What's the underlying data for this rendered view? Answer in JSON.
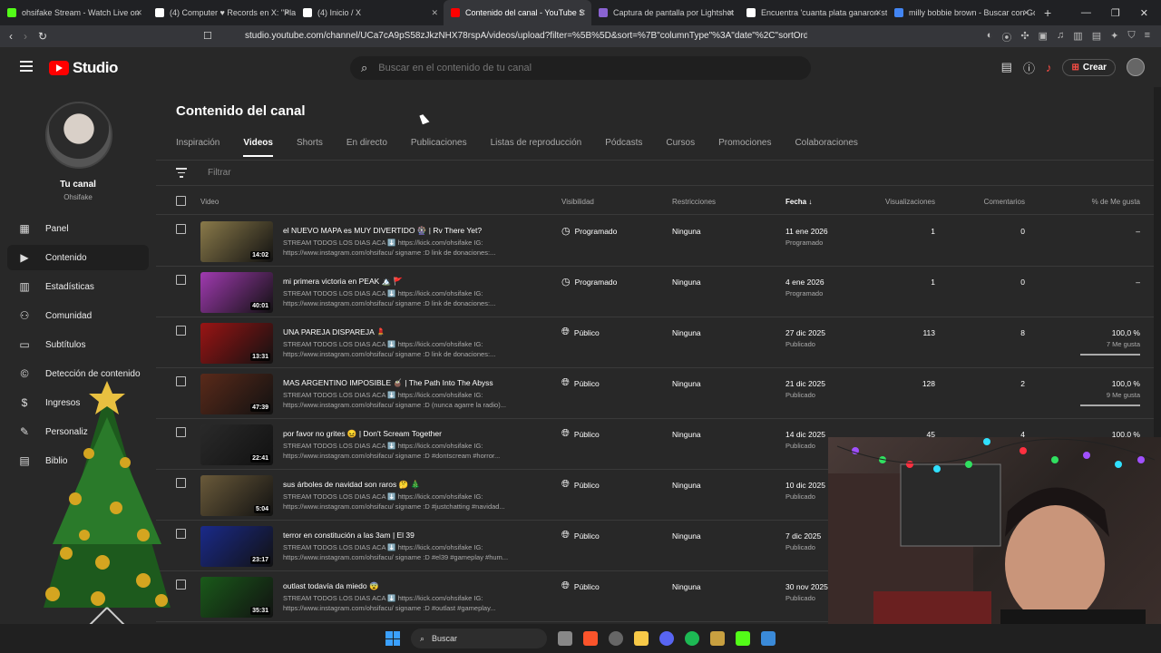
{
  "browser": {
    "tabs": [
      {
        "label": "ohsifake Stream - Watch Live on",
        "color": "#53fc18",
        "active": false
      },
      {
        "label": "(4) Computer ♥ Records en X: \"PlayS",
        "color": "#ffffff",
        "active": false
      },
      {
        "label": "(4) Inicio / X",
        "color": "#ffffff",
        "active": false
      },
      {
        "label": "Contenido del canal - YouTube S",
        "color": "#ff0000",
        "active": true
      },
      {
        "label": "Captura de pantalla por Lightshot",
        "color": "#8a63d2",
        "active": false
      },
      {
        "label": "Encuentra 'cuanta plata ganaron stre",
        "color": "#ffffff",
        "active": false
      },
      {
        "label": "milly bobbie brown - Buscar con Go",
        "color": "#4285f4",
        "active": false
      }
    ],
    "url": "studio.youtube.com/channel/UCa7cA9pS58zJkzNHX78rspA/videos/upload?filter=%5B%5D&sort=%7B\"columnType\"%3A\"date\"%2C\"sortOrder\"%3A\"..."
  },
  "header": {
    "logo_text": "Studio",
    "search_placeholder": "Buscar en el contenido de tu canal",
    "create_label": "Crear"
  },
  "sidebar": {
    "channel_name": "Tu canal",
    "channel_handle": "Ohsifake",
    "items": [
      {
        "label": "Panel",
        "icon": "dashboard-icon"
      },
      {
        "label": "Contenido",
        "icon": "content-icon",
        "active": true
      },
      {
        "label": "Estadísticas",
        "icon": "analytics-icon"
      },
      {
        "label": "Comunidad",
        "icon": "community-icon"
      },
      {
        "label": "Subtítulos",
        "icon": "subtitles-icon"
      },
      {
        "label": "Detección de contenido",
        "icon": "copyright-icon"
      },
      {
        "label": "Ingresos",
        "icon": "earn-icon"
      },
      {
        "label": "Personaliz",
        "icon": "customize-icon"
      },
      {
        "label": "Biblio",
        "icon": "library-icon"
      }
    ]
  },
  "main": {
    "title": "Contenido del canal",
    "tabs": [
      "Inspiración",
      "Videos",
      "Shorts",
      "En directo",
      "Publicaciones",
      "Listas de reproducción",
      "Pódcasts",
      "Cursos",
      "Promociones",
      "Colaboraciones"
    ],
    "active_tab": "Videos",
    "filter_placeholder": "Filtrar",
    "columns": {
      "video": "Video",
      "visibility": "Visibilidad",
      "restrictions": "Restricciones",
      "date": "Fecha",
      "views": "Visualizaciones",
      "comments": "Comentarios",
      "likes": "% de Me gusta"
    },
    "rows": [
      {
        "title": "el NUEVO MAPA es MUY DIVERTIDO 🎡 | Rv There Yet?",
        "desc": "STREAM TODOS LOS DIAS ACA ⬇️ https://kick.com/ohsifake IG: https://www.instagram.com/ohsifacu/ signame :D link de donaciones:...",
        "duration": "14:02",
        "visibility": "Programado",
        "restrictions": "Ninguna",
        "date": "11 ene 2026",
        "date_sub": "Programado",
        "views": "1",
        "comments": "0",
        "likes": "–",
        "likes_sub": "",
        "thumb": "#8a7a4a"
      },
      {
        "title": "mi primera victoria en PEAK 🏔️ 🚩",
        "desc": "STREAM TODOS LOS DIAS ACA ⬇️ https://kick.com/ohsifake IG: https://www.instagram.com/ohsifacu/ signame :D link de donaciones:...",
        "duration": "40:01",
        "visibility": "Programado",
        "restrictions": "Ninguna",
        "date": "4 ene 2026",
        "date_sub": "Programado",
        "views": "1",
        "comments": "0",
        "likes": "–",
        "likes_sub": "",
        "thumb": "#a03ab0"
      },
      {
        "title": "UNA PAREJA DISPAREJA 💄",
        "desc": "STREAM TODOS LOS DIAS ACA ⬇️ https://kick.com/ohsifake IG: https://www.instagram.com/ohsifacu/ signame :D link de donaciones:...",
        "duration": "13:31",
        "visibility": "Público",
        "restrictions": "Ninguna",
        "date": "27 dic 2025",
        "date_sub": "Publicado",
        "views": "113",
        "comments": "8",
        "likes": "100,0 %",
        "likes_sub": "7 Me gusta",
        "thumb": "#9a1414"
      },
      {
        "title": "MAS ARGENTINO IMPOSIBLE 🧉 | The Path Into The Abyss",
        "desc": "STREAM TODOS LOS DIAS ACA ⬇️ https://kick.com/ohsifake IG: https://www.instagram.com/ohsifacu/ signame :D (nunca agarre la radio)...",
        "duration": "47:39",
        "visibility": "Público",
        "restrictions": "Ninguna",
        "date": "21 dic 2025",
        "date_sub": "Publicado",
        "views": "128",
        "comments": "2",
        "likes": "100,0 %",
        "likes_sub": "9 Me gusta",
        "thumb": "#5a2a1a"
      },
      {
        "title": "por favor no grites 😖 | Don't Scream Together",
        "desc": "STREAM TODOS LOS DIAS ACA ⬇️ https://kick.com/ohsifake IG: https://www.instagram.com/ohsifacu/ signame :D #dontscream #horror...",
        "duration": "22:41",
        "visibility": "Público",
        "restrictions": "Ninguna",
        "date": "14 dic 2025",
        "date_sub": "Publicado",
        "views": "45",
        "comments": "4",
        "likes": "100,0 %",
        "likes_sub": "",
        "thumb": "#2a2a2a"
      },
      {
        "title": "sus árboles de navidad son raros 🤔 🎄",
        "desc": "STREAM TODOS LOS DIAS ACA ⬇️ https://kick.com/ohsifake IG: https://www.instagram.com/ohsifacu/ signame :D #justchatting #navidad...",
        "duration": "5:04",
        "visibility": "Público",
        "restrictions": "Ninguna",
        "date": "10 dic 2025",
        "date_sub": "Publicado",
        "views": "",
        "comments": "",
        "likes": "",
        "likes_sub": "",
        "thumb": "#6a5a3a"
      },
      {
        "title": "terror en constitución a las 3am | El 39",
        "desc": "STREAM TODOS LOS DIAS ACA ⬇️ https://kick.com/ohsifake IG: https://www.instagram.com/ohsifacu/ signame :D #el39 #gameplay #hum...",
        "duration": "23:17",
        "visibility": "Público",
        "restrictions": "Ninguna",
        "date": "7 dic 2025",
        "date_sub": "Publicado",
        "views": "",
        "comments": "",
        "likes": "",
        "likes_sub": "",
        "thumb": "#1a2a8a"
      },
      {
        "title": "outlast todavía da miedo 😨",
        "desc": "STREAM TODOS LOS DIAS ACA ⬇️ https://kick.com/ohsifake IG: https://www.instagram.com/ohsifacu/ signame :D #outlast #gameplay...",
        "duration": "35:31",
        "visibility": "Público",
        "restrictions": "Ninguna",
        "date": "30 nov 2025",
        "date_sub": "Publicado",
        "views": "",
        "comments": "",
        "likes": "",
        "likes_sub": "",
        "thumb": "#1a5a1a"
      }
    ]
  },
  "taskbar": {
    "search_label": "Buscar"
  }
}
